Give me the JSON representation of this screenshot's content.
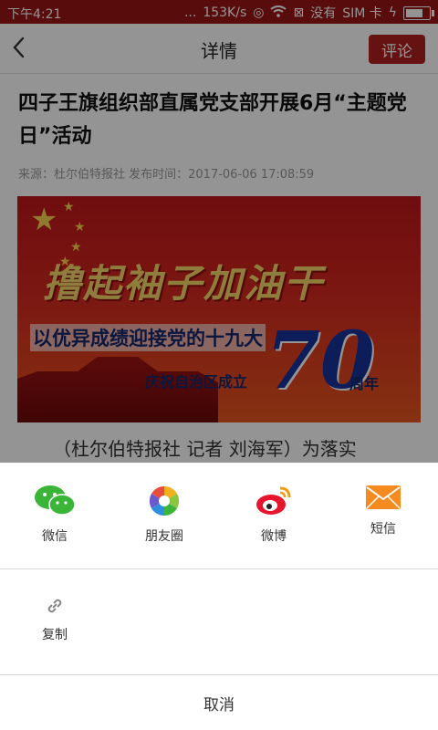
{
  "status_bar": {
    "time": "下午4:21",
    "dots": "...",
    "speed": "153K/s",
    "no_service": "没有",
    "sim": "SIM 卡"
  },
  "header": {
    "title": "详情",
    "comment_label": "评论"
  },
  "article": {
    "title": "四子王旗组织部直属党支部开展6月“主题党日”活动",
    "meta": "来源：杜尔伯特报社 发布时间：2017-06-06 17:08:59",
    "banner": {
      "slogan": "撸起袖子加油干",
      "subline": "以优异成绩迎接党的十九大",
      "anniversary": "庆祝自治区成立",
      "number": "70",
      "suffix": "周年"
    },
    "body_start": "（杜尔伯特报社 记者 刘海军）为落实"
  },
  "share_sheet": {
    "items": [
      {
        "label": "微信",
        "icon": "wechat-icon"
      },
      {
        "label": "朋友圈",
        "icon": "moments-icon"
      },
      {
        "label": "微博",
        "icon": "weibo-icon"
      },
      {
        "label": "短信",
        "icon": "sms-icon"
      }
    ],
    "copy_label": "复制",
    "cancel_label": "取消"
  },
  "colors": {
    "brand_red": "#b22020",
    "status_bar": "#9a1616",
    "wechat_green": "#3bb538",
    "sms_orange": "#f58a1f"
  }
}
